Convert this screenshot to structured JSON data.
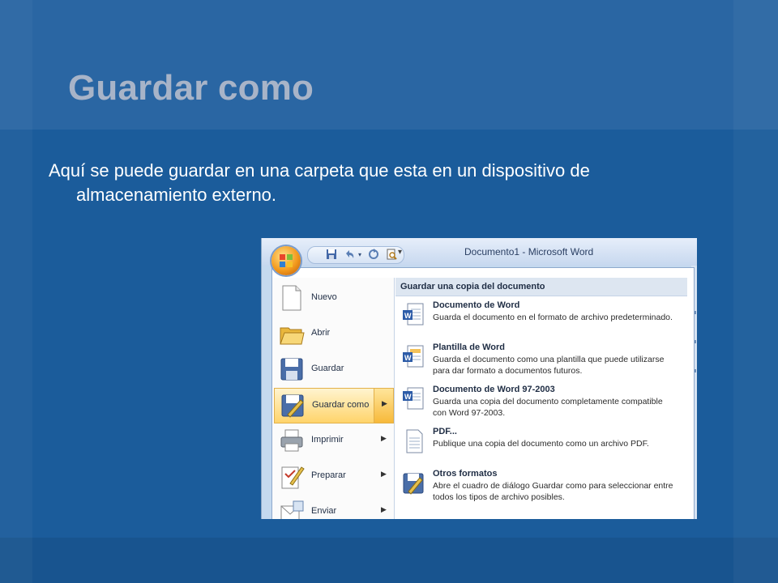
{
  "slide": {
    "title": "Guardar como",
    "body_line1": "Aquí se puede guardar en una carpeta que esta en un dispositivo de",
    "body_line2": "almacenamiento externo."
  },
  "window": {
    "title": "Documento1 - Microsoft Word",
    "quick_access": [
      "save-icon",
      "undo-icon",
      "redo-icon",
      "print-preview-icon"
    ]
  },
  "menu": {
    "items": [
      {
        "label": "Nuevo",
        "icon": "new-document-icon",
        "submenu": false
      },
      {
        "label": "Abrir",
        "icon": "open-folder-icon",
        "submenu": false
      },
      {
        "label": "Guardar",
        "icon": "floppy-disk-icon",
        "submenu": false
      },
      {
        "label": "Guardar como",
        "icon": "save-as-icon",
        "submenu": true,
        "active": true
      },
      {
        "label": "Imprimir",
        "icon": "printer-icon",
        "submenu": true
      },
      {
        "label": "Preparar",
        "icon": "prepare-icon",
        "submenu": true
      },
      {
        "label": "Enviar",
        "icon": "send-icon",
        "submenu": true
      }
    ]
  },
  "submenu": {
    "header": "Guardar una copia del documento",
    "options": [
      {
        "title": "Documento de Word",
        "desc": "Guarda el documento en el formato de archivo predeterminado.",
        "icon": "word-document-icon"
      },
      {
        "title": "Plantilla de Word",
        "desc": "Guarda el documento como una plantilla que puede utilizarse para dar formato a documentos futuros.",
        "icon": "word-template-icon"
      },
      {
        "title": "Documento de Word 97-2003",
        "desc": "Guarda una copia del documento completamente compatible con Word 97-2003.",
        "icon": "word-97-2003-icon"
      },
      {
        "title": "PDF...",
        "desc": "Publique una copia del documento como un archivo PDF.",
        "icon": "pdf-document-icon"
      },
      {
        "title": "Otros formatos",
        "desc": "Abre el cuadro de diálogo Guardar como para seleccionar entre todos los tipos de archivo posibles.",
        "icon": "other-formats-icon"
      }
    ]
  },
  "colors": {
    "background": "#1b5c9b",
    "title": "#a8b4c8",
    "highlight": "#ffd46b"
  }
}
